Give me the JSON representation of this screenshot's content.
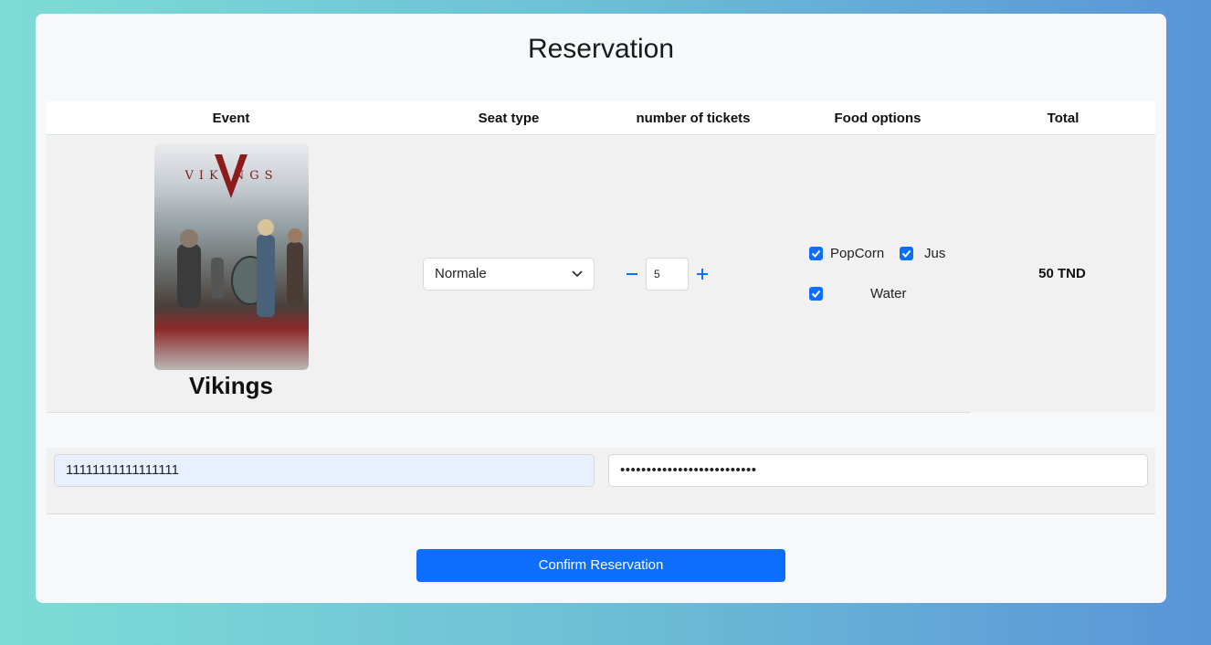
{
  "page": {
    "title": "Reservation"
  },
  "table": {
    "headers": [
      "Event",
      "Seat type",
      "number of tickets",
      "Food options",
      "Total"
    ],
    "row": {
      "poster_title": "VIKINGS",
      "event_name": "Vikings",
      "seat_type": "Normale",
      "tickets": "5",
      "food": [
        {
          "label": "PopCorn",
          "checked": true
        },
        {
          "label": "Jus",
          "checked": true
        },
        {
          "label": "Water",
          "checked": true
        }
      ],
      "total": "50 TND"
    }
  },
  "payment": {
    "card_number": "11111111111111111",
    "password_mask": "••••••••••••••••••••••••••"
  },
  "actions": {
    "confirm_label": "Confirm Reservation"
  },
  "icons": {
    "minus": "minus-icon",
    "plus": "plus-icon",
    "check": "check-icon",
    "chevron": "chevron-down-icon"
  },
  "colors": {
    "accent": "#0d6efd"
  }
}
